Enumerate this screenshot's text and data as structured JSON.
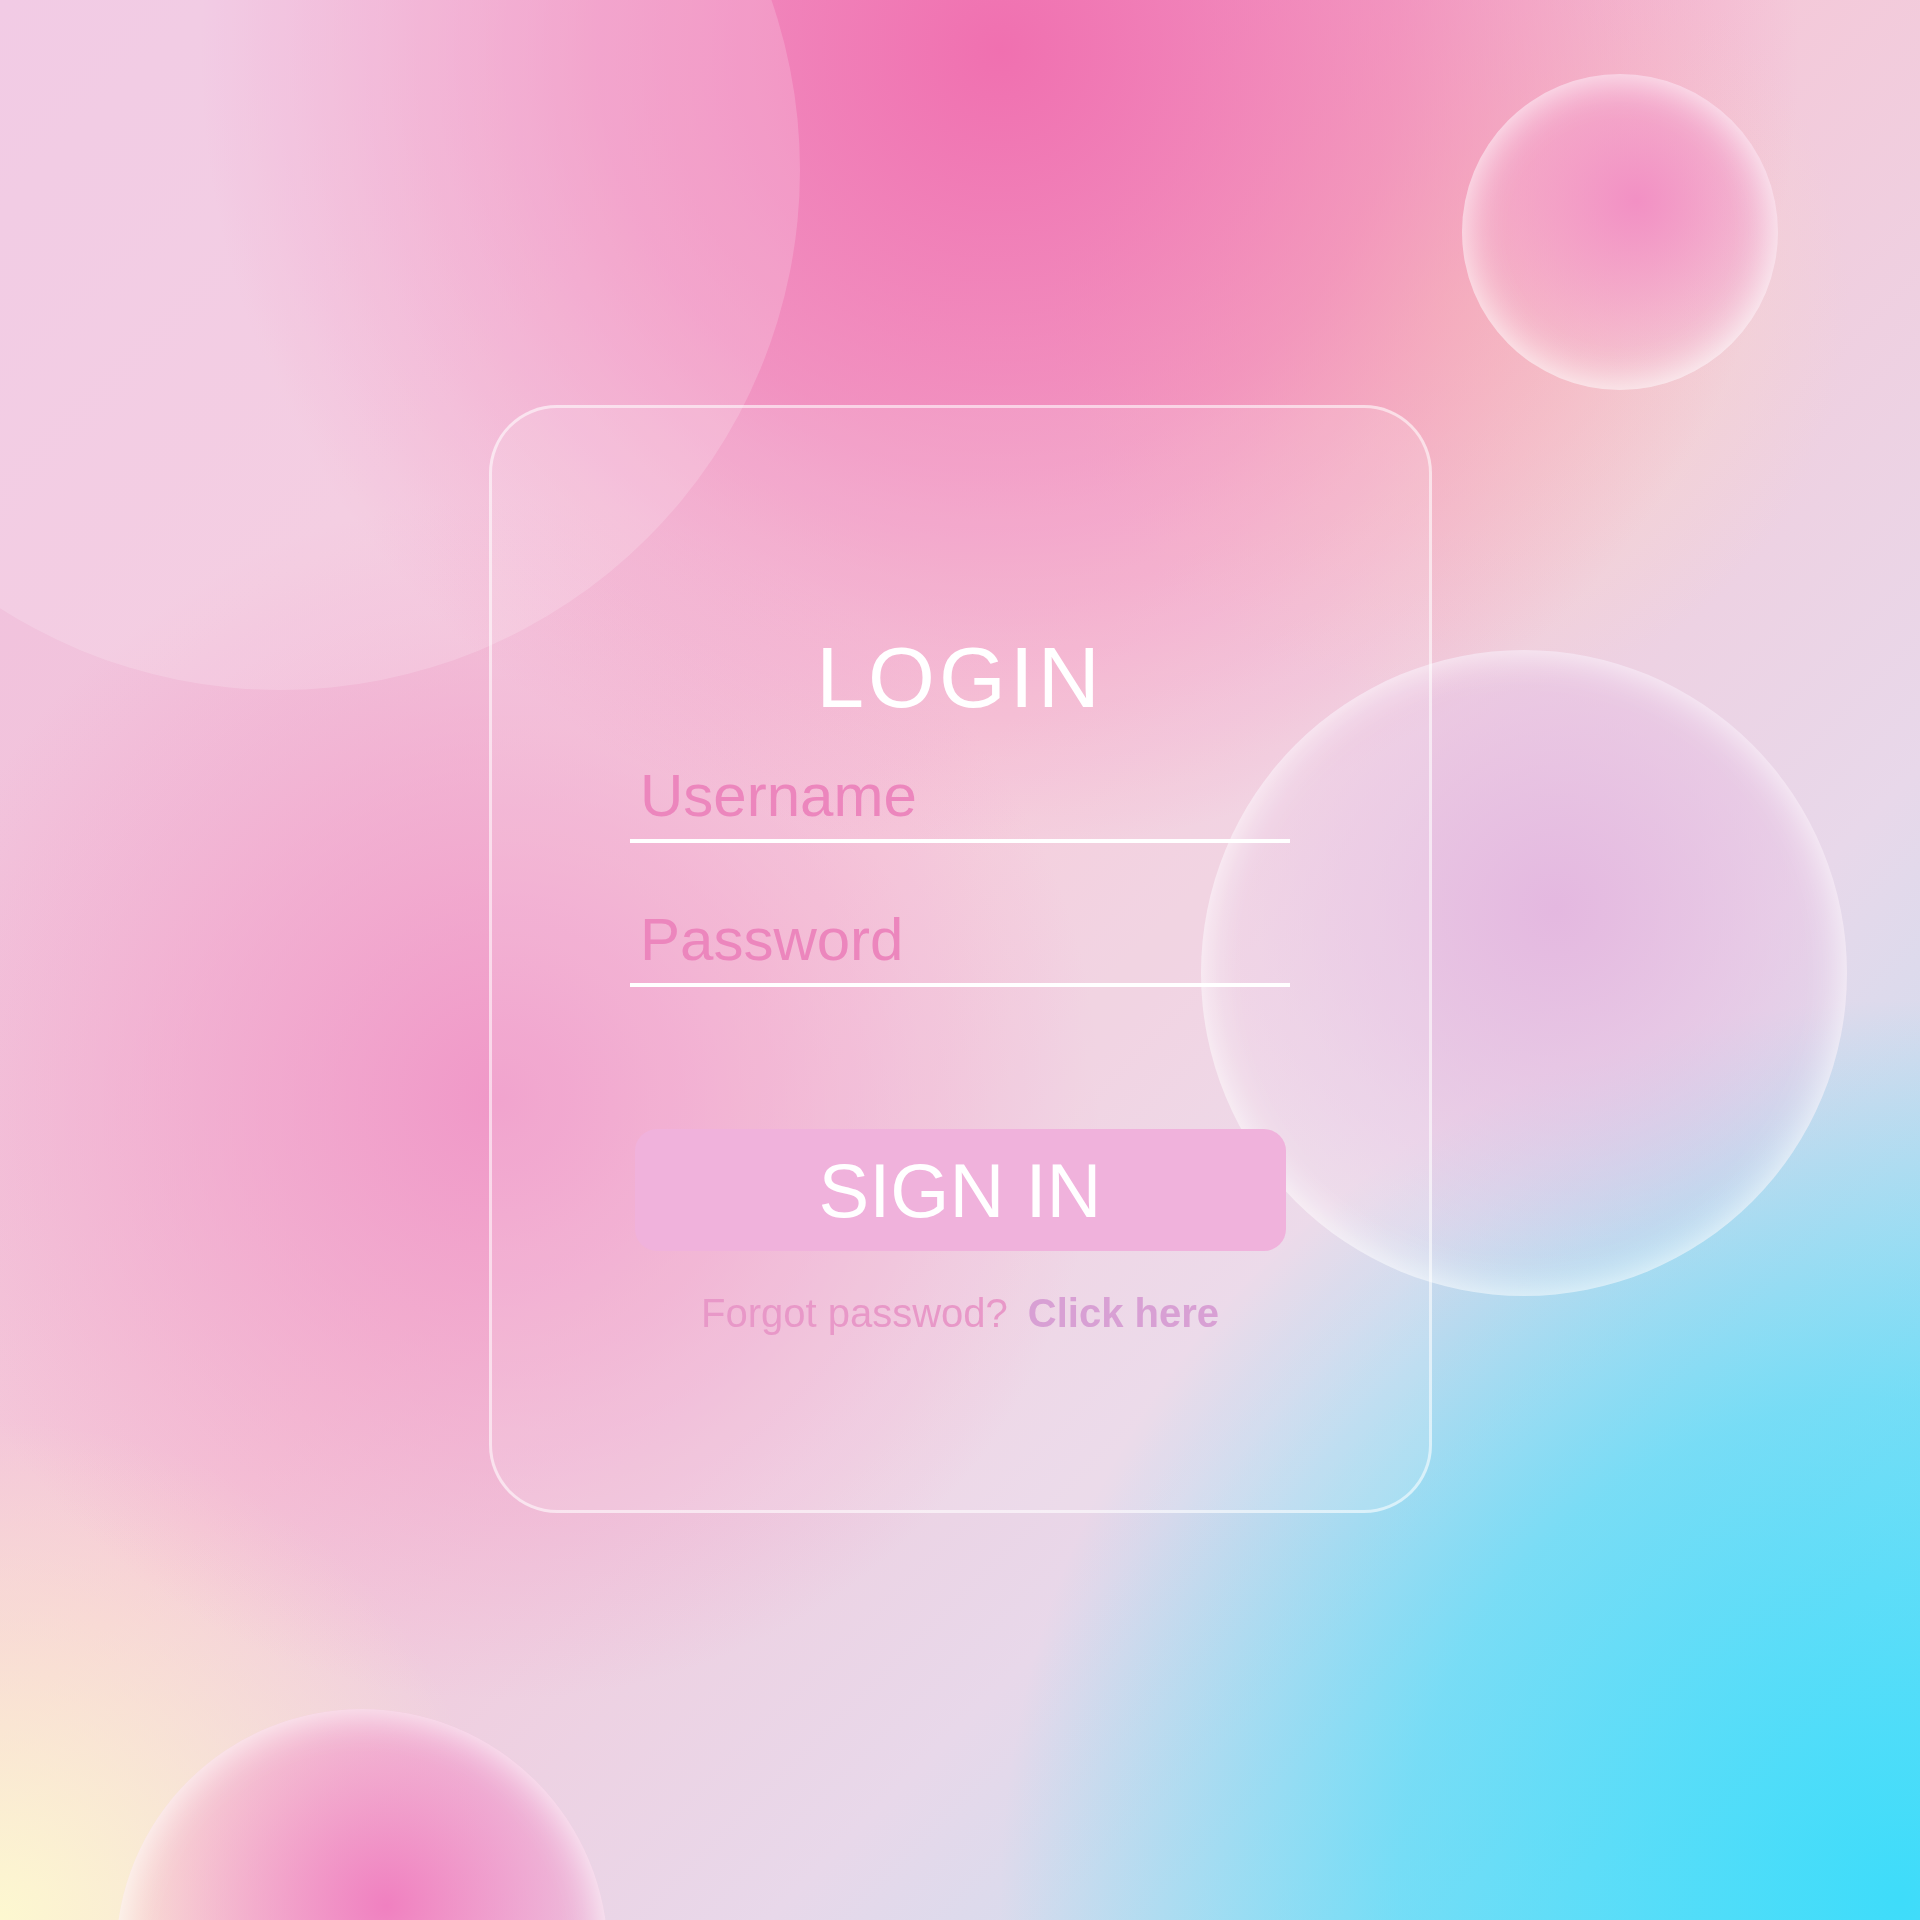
{
  "title": "LOGIN",
  "fields": [
    {
      "placeholder": "Username"
    },
    {
      "placeholder": "Password"
    }
  ],
  "button": "SIGN IN",
  "forgot": {
    "text": "Forgot passwod?",
    "link": "Click here"
  }
}
